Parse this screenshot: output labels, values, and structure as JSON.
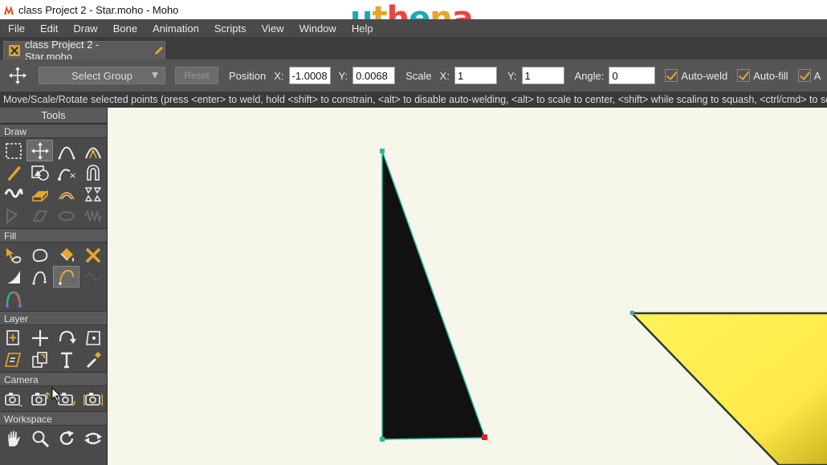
{
  "titlebar": {
    "title": "class Project 2 - Star.moho - Moho"
  },
  "watermark": {
    "letters": [
      "u",
      "t",
      "h",
      "e",
      "n",
      "a"
    ],
    "colors": [
      "#1fa7b8",
      "#e8a62f",
      "#e8473f",
      "#1fa7b8",
      "#e8a62f",
      "#e8473f"
    ]
  },
  "menu": {
    "items": [
      {
        "label": "File"
      },
      {
        "label": "Edit"
      },
      {
        "label": "Draw"
      },
      {
        "label": "Bone"
      },
      {
        "label": "Animation"
      },
      {
        "label": "Scripts"
      },
      {
        "label": "View"
      },
      {
        "label": "Window"
      },
      {
        "label": "Help"
      }
    ]
  },
  "doc_tab": {
    "label": "class Project 2 - Star.moho"
  },
  "options": {
    "select_group": "Select Group",
    "reset": "Reset",
    "position_label": "Position",
    "x_label": "X:",
    "x_value": "-1.0008",
    "y_label": "Y:",
    "y_value": "0.0068",
    "scale_label": "Scale",
    "scale_x_label": "X:",
    "scale_x_value": "1",
    "scale_y_label": "Y:",
    "scale_y_value": "1",
    "angle_label": "Angle:",
    "angle_value": "0",
    "auto_weld": "Auto-weld",
    "auto_fill": "Auto-fill",
    "auto_third": "A"
  },
  "status": {
    "text": "Move/Scale/Rotate selected points (press <enter> to weld, hold <shift> to constrain, <alt> to disable auto-welding, <alt> to scale to center, <shift> while scaling to squash, <ctrl/cmd> to select points)"
  },
  "tools": {
    "header": "Tools",
    "draw_label": "Draw",
    "fill_label": "Fill",
    "layer_label": "Layer",
    "camera_label": "Camera",
    "workspace_label": "Workspace",
    "draw_items": [
      {
        "icon": "select-points-icon"
      },
      {
        "icon": "transform-points-icon"
      },
      {
        "icon": "add-point-icon"
      },
      {
        "icon": "curvature-icon"
      },
      {
        "icon": "freehand-icon"
      },
      {
        "icon": "shape-icon"
      },
      {
        "icon": "delete-edge-icon"
      },
      {
        "icon": "magnet-icon"
      },
      {
        "icon": "blob-brush-icon"
      },
      {
        "icon": "eraser-icon"
      },
      {
        "icon": "perspective-points-icon"
      },
      {
        "icon": "shear-points-icon"
      },
      {
        "icon": "bend-points-icon"
      },
      {
        "icon": "noise-icon"
      },
      {
        "icon": "warp-icon"
      },
      {
        "icon": "curve-profile-icon"
      }
    ],
    "fill_items": [
      {
        "icon": "select-shape-icon"
      },
      {
        "icon": "create-shape-icon"
      },
      {
        "icon": "paint-bucket-icon"
      },
      {
        "icon": "delete-shape-icon"
      },
      {
        "icon": "line-width-icon"
      },
      {
        "icon": "hide-edge-icon"
      },
      {
        "icon": "stroke-exposure-icon"
      },
      {
        "icon": "curve-exposure-icon"
      },
      {
        "icon": "color-points-icon"
      }
    ],
    "layer_items": [
      {
        "icon": "translate-layer-icon"
      },
      {
        "icon": "scale-layer-icon"
      },
      {
        "icon": "rotate-layer-icon"
      },
      {
        "icon": "set-origin-icon"
      },
      {
        "icon": "shear-layer-icon"
      },
      {
        "icon": "switch-layer-icon"
      },
      {
        "icon": "text-icon"
      },
      {
        "icon": "eyedropper-icon"
      }
    ],
    "camera_items": [
      {
        "icon": "track-camera-icon"
      },
      {
        "icon": "zoom-camera-icon"
      },
      {
        "icon": "roll-camera-icon"
      },
      {
        "icon": "pan-tilt-camera-icon"
      }
    ],
    "workspace_items": [
      {
        "icon": "hand-pan-icon"
      },
      {
        "icon": "zoom-icon"
      },
      {
        "icon": "rotate-workspace-icon"
      },
      {
        "icon": "orbit-workspace-icon"
      }
    ]
  },
  "canvas": {
    "background": "#f7f6ea",
    "triangle_fill": "#111111",
    "star_fill": "#ffe94a",
    "outline": "#2bb5a5",
    "selected_point": "#e02020"
  }
}
